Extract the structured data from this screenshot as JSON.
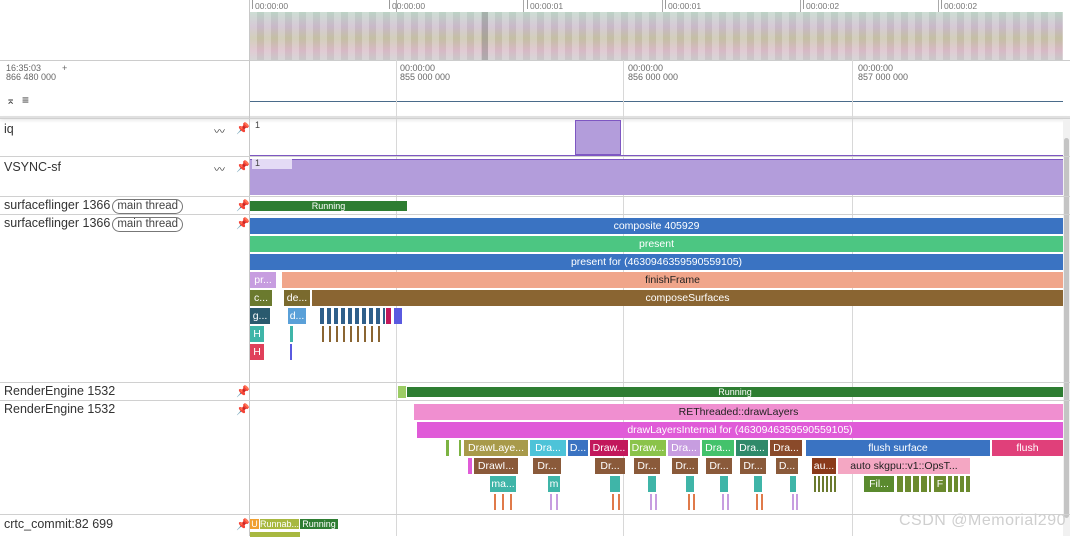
{
  "overview_ticks": [
    "00:00:00",
    "00:00:00",
    "00:00:01",
    "00:00:01",
    "00:00:02",
    "00:00:02"
  ],
  "timeline": {
    "clock": "16:35:03",
    "offset": "866 480 000",
    "plus": "+",
    "ticks": [
      {
        "a": "00:00:00",
        "b": "855 000 000"
      },
      {
        "a": "00:00:00",
        "b": "856 000 000"
      },
      {
        "a": "00:00:00",
        "b": "857 000 000"
      }
    ]
  },
  "tracks": {
    "iq": {
      "name": "iq",
      "value": "1"
    },
    "vsync": {
      "name": "VSYNC-sf",
      "value": "1"
    },
    "sf_state": {
      "name": "surfaceflinger 1366",
      "chip": "main thread",
      "state": "Running"
    },
    "sf": {
      "name": "surfaceflinger 1366",
      "chip": "main thread"
    },
    "re_state": {
      "name": "RenderEngine 1532",
      "state": "Running"
    },
    "re": {
      "name": "RenderEngine 1532"
    },
    "crtc": {
      "name": "crtc_commit:82 699",
      "s1": "U",
      "s2": "Runnab...",
      "s3": "Running"
    }
  },
  "slices": {
    "composite": "composite 405929",
    "present": "present",
    "present_for": "present for  (4630946359590559105)",
    "pr": "pr...",
    "finishFrame": "finishFrame",
    "c": "c...",
    "de": "de...",
    "composeSurfaces": "composeSurfaces",
    "g": "g...",
    "d": "d...",
    "H1": "H",
    "H2": "H",
    "rethreaded": "REThreaded::drawLayers",
    "drawLayersInternal": "drawLayersInternal for  (4630946359590559105)",
    "row3": [
      "DrawLaye...",
      "Dra...",
      "D...",
      "Draw...",
      "Draw...",
      "Dra...",
      "Dra...",
      "Dra...",
      "Dra..."
    ],
    "flush_surface": "flush surface",
    "flush": "flush",
    "row4": [
      "DrawI...",
      "Dr...",
      "Dr...",
      "Dr...",
      "Dr...",
      "Dr...",
      "Dr...",
      "D..."
    ],
    "au": "au...",
    "auto_skgpu": "auto skgpu::v1::OpsT...",
    "ma": "ma...",
    "m": "m",
    "fil": "Fil...",
    "F": "F"
  },
  "watermark": "CSDN @Memorial290",
  "colors": {
    "running": "#2e7d32",
    "purple": "#b39ddb",
    "blue": "#3a73c2",
    "green": "#4cc682",
    "salmon": "#f0a58a",
    "brown": "#8a6532",
    "pink": "#f08fd0",
    "magenta": "#e05bd8"
  }
}
